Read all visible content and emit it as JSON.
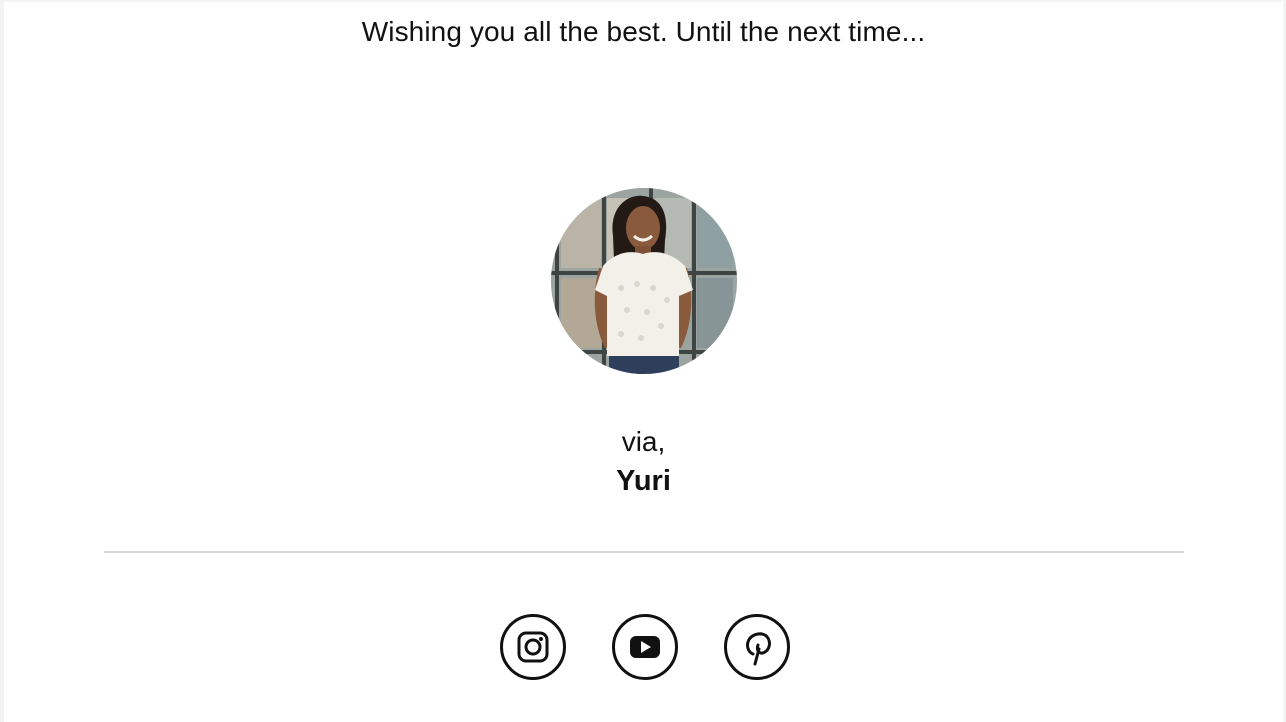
{
  "email": {
    "closing_line": "Wishing you all the best. Until the next time...",
    "signoff": "via,",
    "signature": "Yuri"
  },
  "avatar": {
    "description_icon": "profile-photo"
  },
  "social": {
    "links": [
      {
        "name": "Instagram",
        "icon": "instagram-icon"
      },
      {
        "name": "YouTube",
        "icon": "youtube-icon"
      },
      {
        "name": "Pinterest",
        "icon": "pinterest-icon"
      }
    ]
  },
  "colors": {
    "text": "#111111",
    "divider": "#d4d4d4",
    "background": "#ffffff",
    "page_background": "#f2f3f3"
  }
}
